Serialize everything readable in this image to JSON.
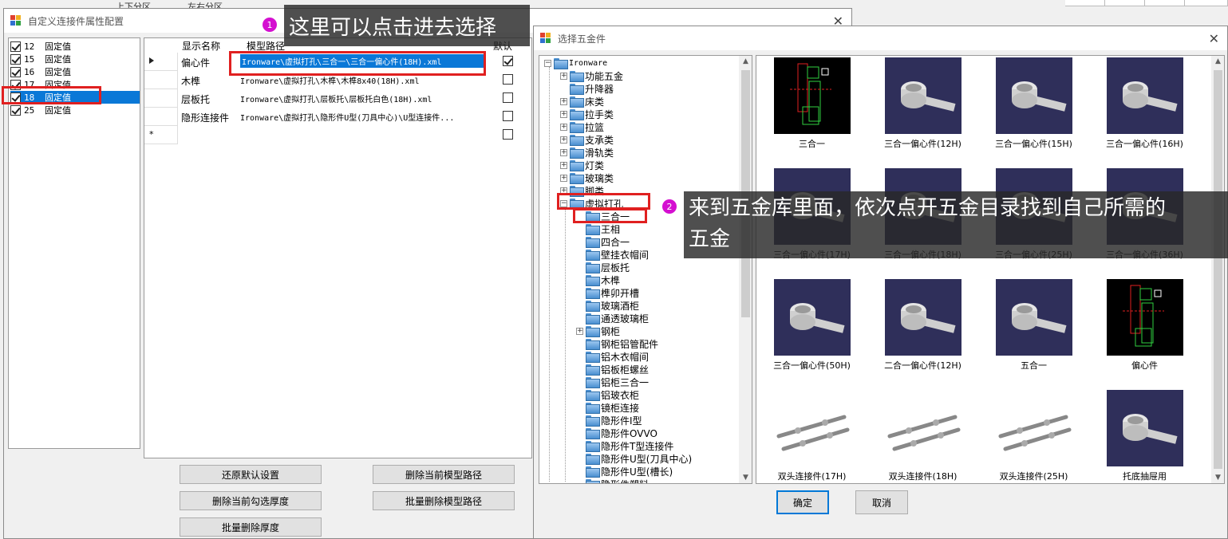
{
  "background_app": {
    "tab_top_bottom": "上下分区",
    "tab_left_right": "左右分区"
  },
  "dialog_config": {
    "title": "自定义连接件属性配置",
    "left_items": [
      {
        "num": "12",
        "label": "固定值",
        "checked": true
      },
      {
        "num": "15",
        "label": "固定值",
        "checked": true
      },
      {
        "num": "16",
        "label": "固定值",
        "checked": true
      },
      {
        "num": "17",
        "label": "固定值",
        "checked": true
      },
      {
        "num": "18",
        "label": "固定值",
        "checked": true
      },
      {
        "num": "25",
        "label": "固定值",
        "checked": true
      }
    ],
    "grid": {
      "headers": {
        "name": "显示名称",
        "path": "模型路径",
        "default": "默认"
      },
      "rows": [
        {
          "name": "偏心件",
          "path": "Ironware\\虚拟打孔\\三合一\\三合一偏心件(18H).xml",
          "default": true
        },
        {
          "name": "木榫",
          "path": "Ironware\\虚拟打孔\\木榫\\木榫8x40(18H).xml",
          "default": false
        },
        {
          "name": "层板托",
          "path": "Ironware\\虚拟打孔\\层板托\\层板托白色(18H).xml",
          "default": false
        },
        {
          "name": "隐形连接件",
          "path": "Ironware\\虚拟打孔\\隐形件U型(刀具中心)\\U型连接件...",
          "default": false
        }
      ],
      "new_row_marker": "*"
    },
    "buttons": {
      "restore_defaults": "还原默认设置",
      "delete_current_path": "删除当前模型路径",
      "delete_checked_thickness": "删除当前勾选厚度",
      "batch_delete_paths": "批量删除模型路径",
      "batch_delete_thickness": "批量删除厚度"
    }
  },
  "dialog_hardware": {
    "title": "选择五金件",
    "tree": {
      "root": "Ironware",
      "level1": [
        "功能五金",
        "升降器",
        "床类",
        "拉手类",
        "拉篮",
        "支承类",
        "滑轨类",
        "灯类",
        "玻璃类",
        "脚类",
        "虚拟打孔"
      ],
      "level2": [
        "三合一",
        "王相",
        "四合一",
        "壁挂衣帽间",
        "层板托",
        "木榫",
        "榫卯开槽",
        "玻璃酒柜",
        "通透玻璃柜",
        "钢柜",
        "钢柜铝管配件",
        "铝木衣帽间",
        "铝板柜螺丝",
        "铝柜三合一",
        "铝玻衣柜",
        "镜柜连接",
        "隐形件I型",
        "隐形件OVVO",
        "隐形件T型连接件",
        "隐形件U型(刀具中心)",
        "隐形件U型(槽长)",
        "隐形件塑料"
      ]
    },
    "gallery": [
      {
        "caption": "三合一",
        "thumb": "diagram"
      },
      {
        "caption": "三合一偏心件(12H)",
        "thumb": "cam"
      },
      {
        "caption": "三合一偏心件(15H)",
        "thumb": "cam"
      },
      {
        "caption": "三合一偏心件(16H)",
        "thumb": "cam"
      },
      {
        "caption": "三合一偏心件(17H)",
        "thumb": "cam"
      },
      {
        "caption": "三合一偏心件(18H)",
        "thumb": "cam"
      },
      {
        "caption": "三合一偏心件(25H)",
        "thumb": "cam"
      },
      {
        "caption": "三合一偏心件(36H)",
        "thumb": "cam"
      },
      {
        "caption": "三合一偏心件(50H)",
        "thumb": "cam"
      },
      {
        "caption": "二合一偏心件(12H)",
        "thumb": "cam"
      },
      {
        "caption": "五合一",
        "thumb": "cam"
      },
      {
        "caption": "偏心件",
        "thumb": "diagram"
      },
      {
        "caption": "双头连接件(17H)",
        "thumb": "rod"
      },
      {
        "caption": "双头连接件(18H)",
        "thumb": "rod"
      },
      {
        "caption": "双头连接件(25H)",
        "thumb": "rod"
      },
      {
        "caption": "托底抽屉用",
        "thumb": "cam"
      }
    ],
    "buttons": {
      "ok": "确定",
      "cancel": "取消"
    }
  },
  "annotations": [
    {
      "badge": "1",
      "text": "这里可以点击进去选择"
    },
    {
      "badge": "2",
      "text_line1": "来到五金库里面，依次点开五金目录找到自己所需的",
      "text_line2": "五金"
    }
  ],
  "colors": {
    "selection": "#0a78d7",
    "highlight_box": "#e02020",
    "badge": "#d40fd0"
  }
}
